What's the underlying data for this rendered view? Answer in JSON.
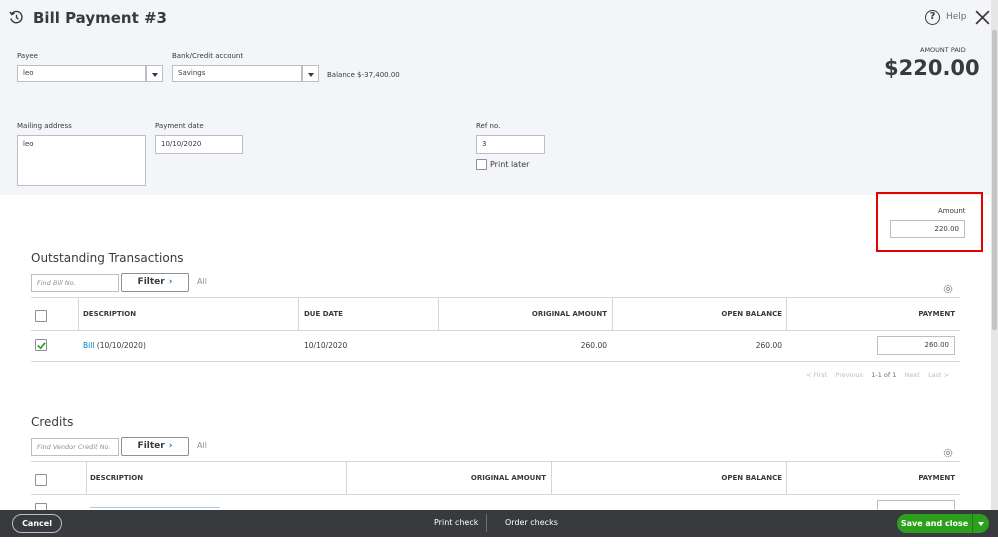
{
  "header": {
    "title": "Bill Payment #3",
    "help_label": "Help"
  },
  "payee": {
    "label": "Payee",
    "value": "leo"
  },
  "bank_account": {
    "label": "Bank/Credit account",
    "value": "Savings",
    "balance_text": "Balance $-37,400.00"
  },
  "amount_paid": {
    "label": "AMOUNT PAID",
    "value": "$220.00"
  },
  "mailing_address": {
    "label": "Mailing address",
    "value": "leo"
  },
  "payment_date": {
    "label": "Payment date",
    "value": "10/10/2020"
  },
  "ref_no": {
    "label": "Ref no.",
    "value": "3"
  },
  "print_later": {
    "label": "Print later",
    "checked": false
  },
  "amount": {
    "label": "Amount",
    "value": "220.00"
  },
  "outstanding": {
    "title": "Outstanding Transactions",
    "search_placeholder": "Find Bill No.",
    "filter_label": "Filter",
    "all_label": "All",
    "columns": [
      "DESCRIPTION",
      "DUE DATE",
      "ORIGINAL AMOUNT",
      "OPEN BALANCE",
      "PAYMENT"
    ],
    "rows": [
      {
        "description_link": "Bill",
        "description_rest": " (10/10/2020)",
        "due_date": "10/10/2020",
        "original_amount": "260.00",
        "open_balance": "260.00",
        "payment": "260.00",
        "checked": true
      }
    ],
    "pager": {
      "first": "< First",
      "previous": "Previous",
      "range": "1-1 of 1",
      "next": "Next",
      "last": "Last >"
    }
  },
  "credits": {
    "title": "Credits",
    "search_placeholder": "Find Vendor Credit No.",
    "filter_label": "Filter",
    "all_label": "All",
    "columns": [
      "DESCRIPTION",
      "ORIGINAL AMOUNT",
      "OPEN BALANCE",
      "PAYMENT"
    ]
  },
  "footer": {
    "cancel": "Cancel",
    "print_check": "Print check",
    "order_checks": "Order checks",
    "save_close": "Save and close"
  },
  "colors": {
    "primary_green": "#2ca01c",
    "link_blue": "#0077c5",
    "footer_dark": "#393a3d",
    "highlight_red": "#e60000"
  },
  "icons": [
    "history-icon",
    "help-icon",
    "close-icon",
    "chevron-right-icon",
    "gear-icon",
    "caret-down-icon",
    "checkmark-icon"
  ]
}
